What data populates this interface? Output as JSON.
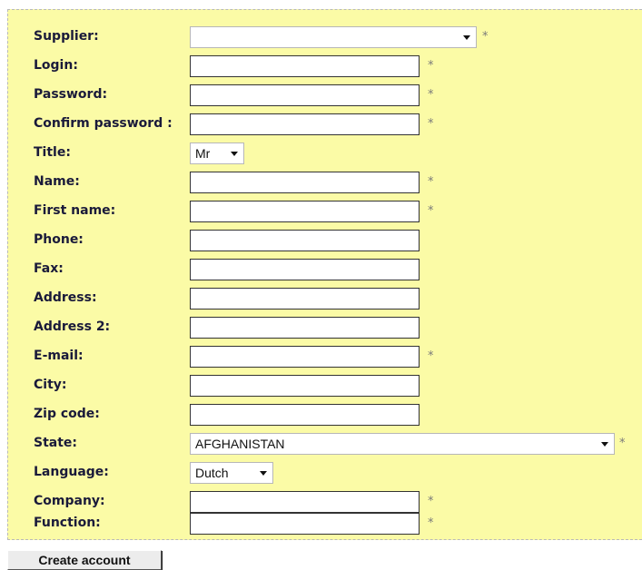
{
  "form": {
    "required_mark": "*",
    "supplier": {
      "label": "Supplier:",
      "value": ""
    },
    "login": {
      "label": "Login:",
      "value": ""
    },
    "password": {
      "label": "Password:",
      "value": ""
    },
    "confirm_password": {
      "label": "Confirm password :",
      "value": ""
    },
    "title": {
      "label": "Title:",
      "value": "Mr"
    },
    "name": {
      "label": "Name:",
      "value": ""
    },
    "first_name": {
      "label": "First name:",
      "value": ""
    },
    "phone": {
      "label": "Phone:",
      "value": ""
    },
    "fax": {
      "label": "Fax:",
      "value": ""
    },
    "address": {
      "label": "Address:",
      "value": ""
    },
    "address2": {
      "label": "Address 2:",
      "value": ""
    },
    "email": {
      "label": "E-mail:",
      "value": ""
    },
    "city": {
      "label": "City:",
      "value": ""
    },
    "zip": {
      "label": "Zip code:",
      "value": ""
    },
    "state": {
      "label": "State:",
      "value": "AFGHANISTAN"
    },
    "language": {
      "label": "Language:",
      "value": "Dutch"
    },
    "company": {
      "label": "Company:",
      "value": ""
    },
    "function": {
      "label": "Function:",
      "value": ""
    }
  },
  "actions": {
    "create_account_label": "Create account"
  }
}
